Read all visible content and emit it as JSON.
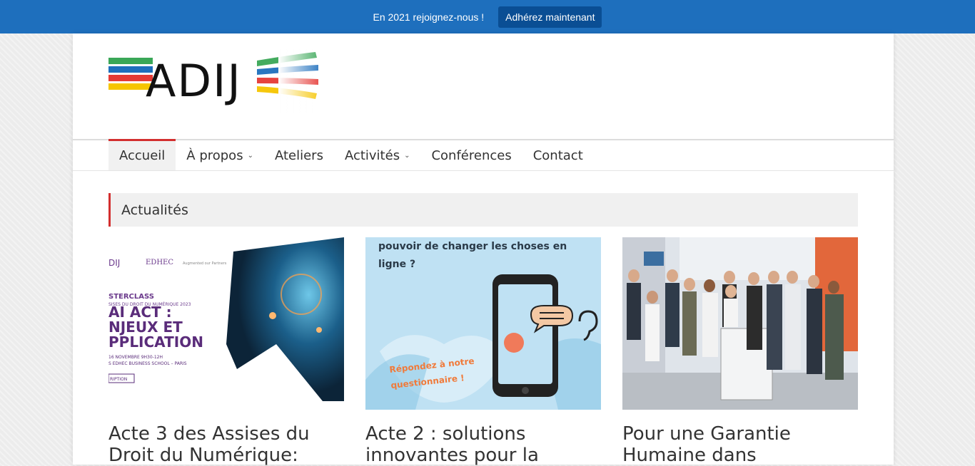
{
  "topbar": {
    "message": "En 2021 rejoignez-nous !",
    "button_label": "Adhérez maintenant"
  },
  "logo": {
    "text": "ADIJ"
  },
  "nav": {
    "items": [
      {
        "label": "Accueil"
      },
      {
        "label": "À propos"
      },
      {
        "label": "Ateliers"
      },
      {
        "label": "Activités"
      },
      {
        "label": "Conférences"
      },
      {
        "label": "Contact"
      }
    ]
  },
  "section": {
    "title": "Actualités"
  },
  "cards": [
    {
      "title": "Acte 3 des Assises du Droit du Numérique:",
      "image_text": {
        "masterclass": "STERCLASS",
        "line2": "SISES DU DROIT DU NUMÉRIQUE 2023",
        "heading1": "AI ACT :",
        "heading2": "NJEUX ET",
        "heading3": "PPLICATION",
        "date": "16 NOVEMBRE 9H30-12H",
        "place": "S EDHEC BUSINESS SCHOOL – PARIS",
        "inscription": "RIPTION",
        "edhec": "EDHEC",
        "adij": "DIJ",
        "tagline": "Augmented our Partners"
      }
    },
    {
      "title": "Acte 2 : solutions innovantes pour la",
      "image_text": {
        "question1": "pouvoir de changer les choses en",
        "question2": "ligne ?",
        "cta1": "Répondez à notre",
        "cta2": "questionnaire !"
      }
    },
    {
      "title": "Pour une Garantie Humaine dans",
      "image_text": {}
    }
  ],
  "colors": {
    "topbar": "#1e6fbd",
    "topbar_button": "#0a4e94",
    "accent_red": "#d32f2f"
  }
}
